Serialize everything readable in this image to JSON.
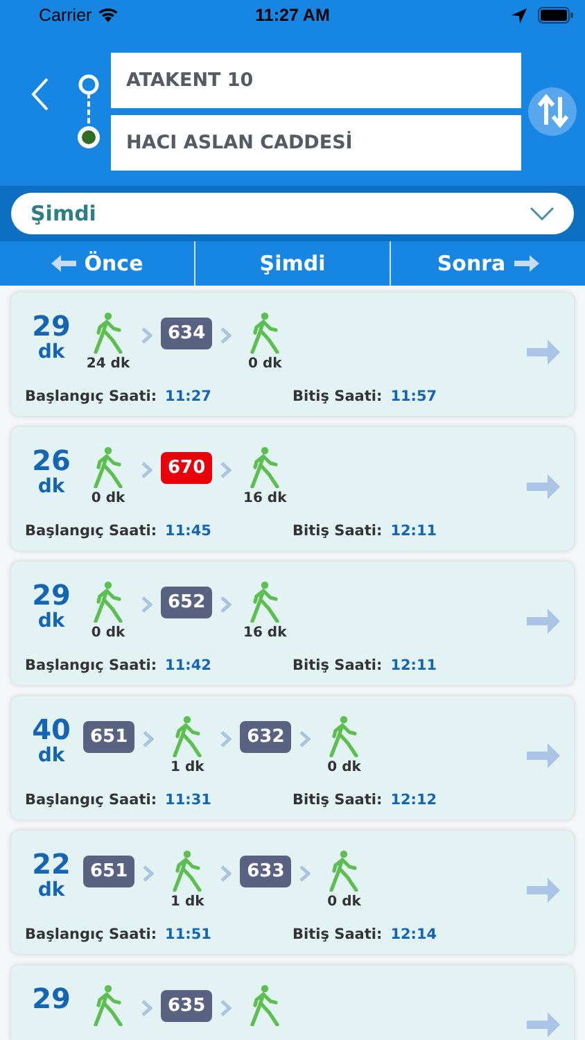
{
  "status_bar": {
    "carrier": "Carrier",
    "time": "11:27 AM"
  },
  "route": {
    "from": "ATAKENT 10",
    "to": "HACI ASLAN CADDESİ"
  },
  "time_select": {
    "value": "Şimdi"
  },
  "tabs": [
    {
      "label": "Önce",
      "kind": "back"
    },
    {
      "label": "Şimdi",
      "kind": "plain"
    },
    {
      "label": "Sonra",
      "kind": "forward"
    }
  ],
  "results": [
    {
      "duration": "29",
      "unit": "dk",
      "steps": [
        {
          "kind": "walk",
          "time": "24 dk"
        },
        {
          "kind": "bus",
          "line": "634",
          "color": "#5a6282"
        },
        {
          "kind": "walk",
          "time": "0 dk"
        }
      ],
      "start_label": "Başlangıç Saati:",
      "start_time": "11:27",
      "end_label": "Bitiş Saati:",
      "end_time": "11:57"
    },
    {
      "duration": "26",
      "unit": "dk",
      "steps": [
        {
          "kind": "walk",
          "time": "0 dk"
        },
        {
          "kind": "bus",
          "line": "670",
          "color": "#e8000b"
        },
        {
          "kind": "walk",
          "time": "16 dk"
        }
      ],
      "start_label": "Başlangıç Saati:",
      "start_time": "11:45",
      "end_label": "Bitiş Saati:",
      "end_time": "12:11"
    },
    {
      "duration": "29",
      "unit": "dk",
      "steps": [
        {
          "kind": "walk",
          "time": "0 dk"
        },
        {
          "kind": "bus",
          "line": "652",
          "color": "#5a6282"
        },
        {
          "kind": "walk",
          "time": "16 dk"
        }
      ],
      "start_label": "Başlangıç Saati:",
      "start_time": "11:42",
      "end_label": "Bitiş Saati:",
      "end_time": "12:11"
    },
    {
      "duration": "40",
      "unit": "dk",
      "steps": [
        {
          "kind": "bus",
          "line": "651",
          "color": "#5a6282"
        },
        {
          "kind": "walk",
          "time": "1 dk"
        },
        {
          "kind": "bus",
          "line": "632",
          "color": "#5a6282"
        },
        {
          "kind": "walk",
          "time": "0 dk"
        }
      ],
      "start_label": "Başlangıç Saati:",
      "start_time": "11:31",
      "end_label": "Bitiş Saati:",
      "end_time": "12:12"
    },
    {
      "duration": "22",
      "unit": "dk",
      "steps": [
        {
          "kind": "bus",
          "line": "651",
          "color": "#5a6282"
        },
        {
          "kind": "walk",
          "time": "1 dk"
        },
        {
          "kind": "bus",
          "line": "633",
          "color": "#5a6282"
        },
        {
          "kind": "walk",
          "time": "0 dk"
        }
      ],
      "start_label": "Başlangıç Saati:",
      "start_time": "11:51",
      "end_label": "Bitiş Saati:",
      "end_time": "12:14"
    },
    {
      "duration": "29",
      "steps": [
        {
          "kind": "walk"
        },
        {
          "kind": "bus",
          "line": "635",
          "color": "#5a6282"
        },
        {
          "kind": "walk"
        }
      ]
    }
  ]
}
